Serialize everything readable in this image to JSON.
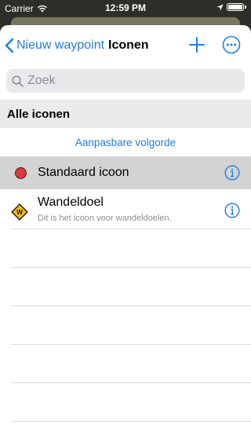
{
  "status": {
    "carrier": "Carrier",
    "time": "12:59 PM"
  },
  "nav": {
    "back_label": "Nieuw waypoint",
    "title": "Iconen"
  },
  "search": {
    "placeholder": "Zoek"
  },
  "section": {
    "title": "Alle iconen"
  },
  "order_link": "Aanpasbare volgorde",
  "rows": [
    {
      "label": "Standaard icoon",
      "icon": "red-dot-icon"
    },
    {
      "label": "Wandeldoel",
      "subtitle": "Dit is het icoon voor wandeldoelen.",
      "icon": "hiking-sign-icon"
    }
  ],
  "colors": {
    "accent": "#1f7fe0",
    "selected_row": "#d3d3d6",
    "section_bg": "#ebebee"
  }
}
